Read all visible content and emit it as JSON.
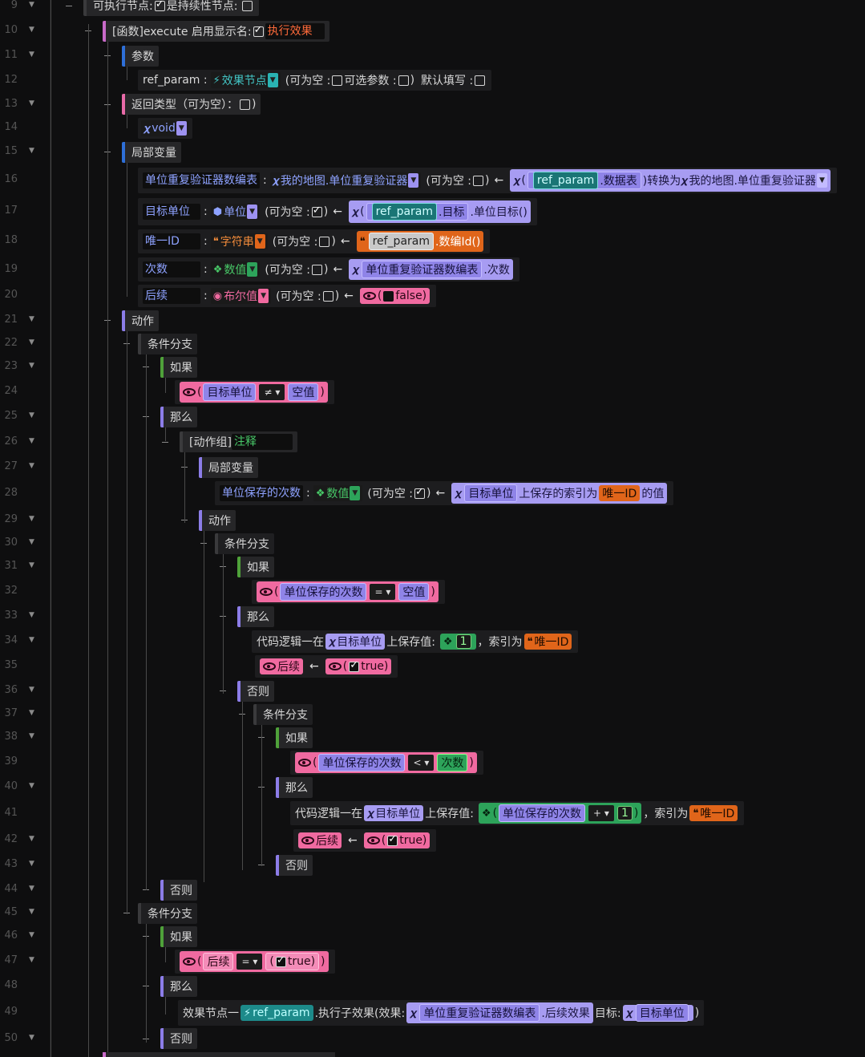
{
  "line_numbers": [
    "9",
    "10",
    "11",
    "12",
    "13",
    "14",
    "15",
    "16",
    "17",
    "18",
    "19",
    "20",
    "21",
    "22",
    "23",
    "24",
    "25",
    "26",
    "27",
    "28",
    "29",
    "30",
    "31",
    "32",
    "33",
    "34",
    "35",
    "36",
    "37",
    "38",
    "39",
    "40",
    "41",
    "42",
    "43",
    "44",
    "45",
    "46",
    "47",
    "48",
    "49",
    "50"
  ],
  "fold_glyph": "▼",
  "collapse_glyph": "–",
  "arrow": "←",
  "l9": {
    "a": "可执行节点:",
    "b": "是持续性节点:"
  },
  "l10": {
    "a": "[函数]execute 启用显示名:",
    "name": "执行效果"
  },
  "l11": {
    "label": "参数"
  },
  "l12": {
    "name": "ref_param :",
    "type": "效果节点",
    "nullable": "(可为空 :",
    "optional": "可选参数 :",
    "close": ")",
    "default": "默认填写 :"
  },
  "l13": {
    "label": "返回类型（可为空）：",
    "close": ")"
  },
  "l14": {
    "type": "void"
  },
  "l15": {
    "label": "局部变量"
  },
  "l16": {
    "name": "单位重复验证器数编表",
    "colon": ":",
    "type": "我的地图.单位重复验证器",
    "nullable": "(可为空 :",
    "close": ")",
    "open": "(",
    "p1": "ref_param",
    "p2": ".数据表",
    "conv": ")转换为",
    "ctype": "我的地图.单位重复验证器"
  },
  "l17": {
    "name": "目标单位",
    "colon": ":",
    "type": "单位",
    "nullable": "(可为空 :",
    "close": ")",
    "open": "(",
    "p1": "ref_param",
    "p2": ".目标",
    "p3": ".单位目标()"
  },
  "l18": {
    "name": "唯一ID",
    "colon": ":",
    "type": "字符串",
    "nullable": "(可为空 :",
    "close": ")",
    "p1": "ref_param",
    "p2": ".数编Id()"
  },
  "l19": {
    "name": "次数",
    "colon": ":",
    "type": "数值",
    "nullable": "(可为空 :",
    "close": ")",
    "p1": "单位重复验证器数编表",
    "p2": ".次数"
  },
  "l20": {
    "name": "后续",
    "colon": ":",
    "type": "布尔值",
    "nullable": "(可为空 :",
    "close": ")",
    "open": "(",
    "val": "false)"
  },
  "l21": {
    "label": "动作"
  },
  "l22": {
    "label": "条件分支"
  },
  "l23": {
    "label": "如果"
  },
  "l24": {
    "open": "(",
    "a": "目标单位",
    "op": "≠ ▾",
    "b": "空值",
    "close": ")"
  },
  "l25": {
    "label": "那么"
  },
  "l26": {
    "a": "[动作组]",
    "b": "注释"
  },
  "l27": {
    "label": "局部变量"
  },
  "l28": {
    "name": "单位保存的次数",
    "colon": ":",
    "type": "数值",
    "nullable": "(可为空 :",
    "close": ")",
    "p1": "目标单位",
    "p2": "上保存的索引为",
    "p3": "唯一ID",
    "p4": "的值"
  },
  "l29": {
    "label": "动作"
  },
  "l30": {
    "label": "条件分支"
  },
  "l31": {
    "label": "如果"
  },
  "l32": {
    "open": "(",
    "a": "单位保存的次数",
    "op": "= ▾",
    "b": "空值",
    "close": ")"
  },
  "l33": {
    "label": "那么"
  },
  "l34": {
    "a": "代码逻辑一在",
    "b": "目标单位",
    "c": "上保存值:",
    "num": "1",
    "d": "，索引为",
    "e": "唯一ID"
  },
  "l35": {
    "a": "后续",
    "open": "(",
    "val": "true)"
  },
  "l36": {
    "label": "否则"
  },
  "l37": {
    "label": "条件分支"
  },
  "l38": {
    "label": "如果"
  },
  "l39": {
    "open": "(",
    "a": "单位保存的次数",
    "op": "< ▾",
    "b": "次数",
    "close": ")"
  },
  "l40": {
    "label": "那么"
  },
  "l41": {
    "a": "代码逻辑一在",
    "b": "目标单位",
    "c": "上保存值:",
    "open": "(",
    "d": "单位保存的次数",
    "op": "+ ▾",
    "num": "1",
    "close": ")",
    "e": "，索引为",
    "f": "唯一ID"
  },
  "l42": {
    "a": "后续",
    "open": "(",
    "val": "true)"
  },
  "l43": {
    "label": "否则"
  },
  "l44": {
    "label": "否则"
  },
  "l45": {
    "label": "条件分支"
  },
  "l46": {
    "label": "如果"
  },
  "l47": {
    "open": "(",
    "a": "后续",
    "op": "= ▾",
    "open2": "(",
    "val": "true)",
    "close": ")"
  },
  "l48": {
    "label": "那么"
  },
  "l49": {
    "a": "效果节点一",
    "b": "ref_param",
    "c": ".执行子效果(效果:",
    "d": "单位重复验证器数编表",
    "e": ".后续效果",
    "f": "目标:",
    "g": "目标单位",
    "close": ")"
  },
  "l50": {
    "label": "否则"
  },
  "colors": {
    "purple": "#a79cf2",
    "teal": "#1d8a8a",
    "orange": "#e0651a",
    "pink": "#f06aa0",
    "green": "#2da35a",
    "blue_bar": "#2e6fd8"
  }
}
